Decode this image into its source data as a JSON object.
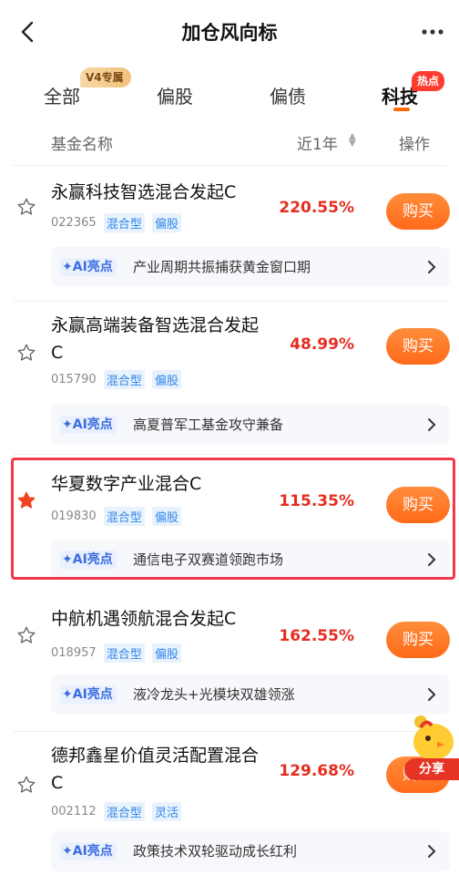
{
  "nav": {
    "title": "加仓风向标"
  },
  "tabs": [
    {
      "label": "全部",
      "badge": "V4专属"
    },
    {
      "label": "偏股"
    },
    {
      "label": "偏债"
    },
    {
      "label": "科技",
      "badge": "热点",
      "active": true
    }
  ],
  "header": {
    "col_name": "基金名称",
    "col_return": "近1年",
    "col_action": "操作"
  },
  "ai_label": "AI亮点",
  "funds": [
    {
      "name": "永赢科技智选混合发起C",
      "code": "022365",
      "tags": [
        "混合型",
        "偏股"
      ],
      "return": "220.55%",
      "buy": "购买",
      "starred": false,
      "ai": "产业周期共振捕获黄金窗口期"
    },
    {
      "name": "永赢高端装备智选混合发起C",
      "code": "015790",
      "tags": [
        "混合型",
        "偏股"
      ],
      "return": "48.99%",
      "buy": "购买",
      "starred": false,
      "ai": "高夏普军工基金攻守兼备"
    },
    {
      "name": "华夏数字产业混合C",
      "code": "019830",
      "tags": [
        "混合型",
        "偏股"
      ],
      "return": "115.35%",
      "buy": "购买",
      "starred": true,
      "ai": "通信电子双赛道领跑市场"
    },
    {
      "name": "中航机遇领航混合发起C",
      "code": "018957",
      "tags": [
        "混合型",
        "偏股"
      ],
      "return": "162.55%",
      "buy": "购买",
      "starred": false,
      "ai": "液冷龙头+光模块双雄领涨"
    },
    {
      "name": "德邦鑫星价值灵活配置混合C",
      "code": "002112",
      "tags": [
        "混合型",
        "灵活"
      ],
      "return": "129.68%",
      "buy": "购买",
      "starred": false,
      "ai": "政策技术双轮驱动成长红利"
    }
  ],
  "share": {
    "label": "分享"
  },
  "colors": {
    "accent": "#ff6a1a",
    "return_red": "#e52d20",
    "tag_blue": "#2f86e9",
    "highlight": "#f0384a"
  }
}
